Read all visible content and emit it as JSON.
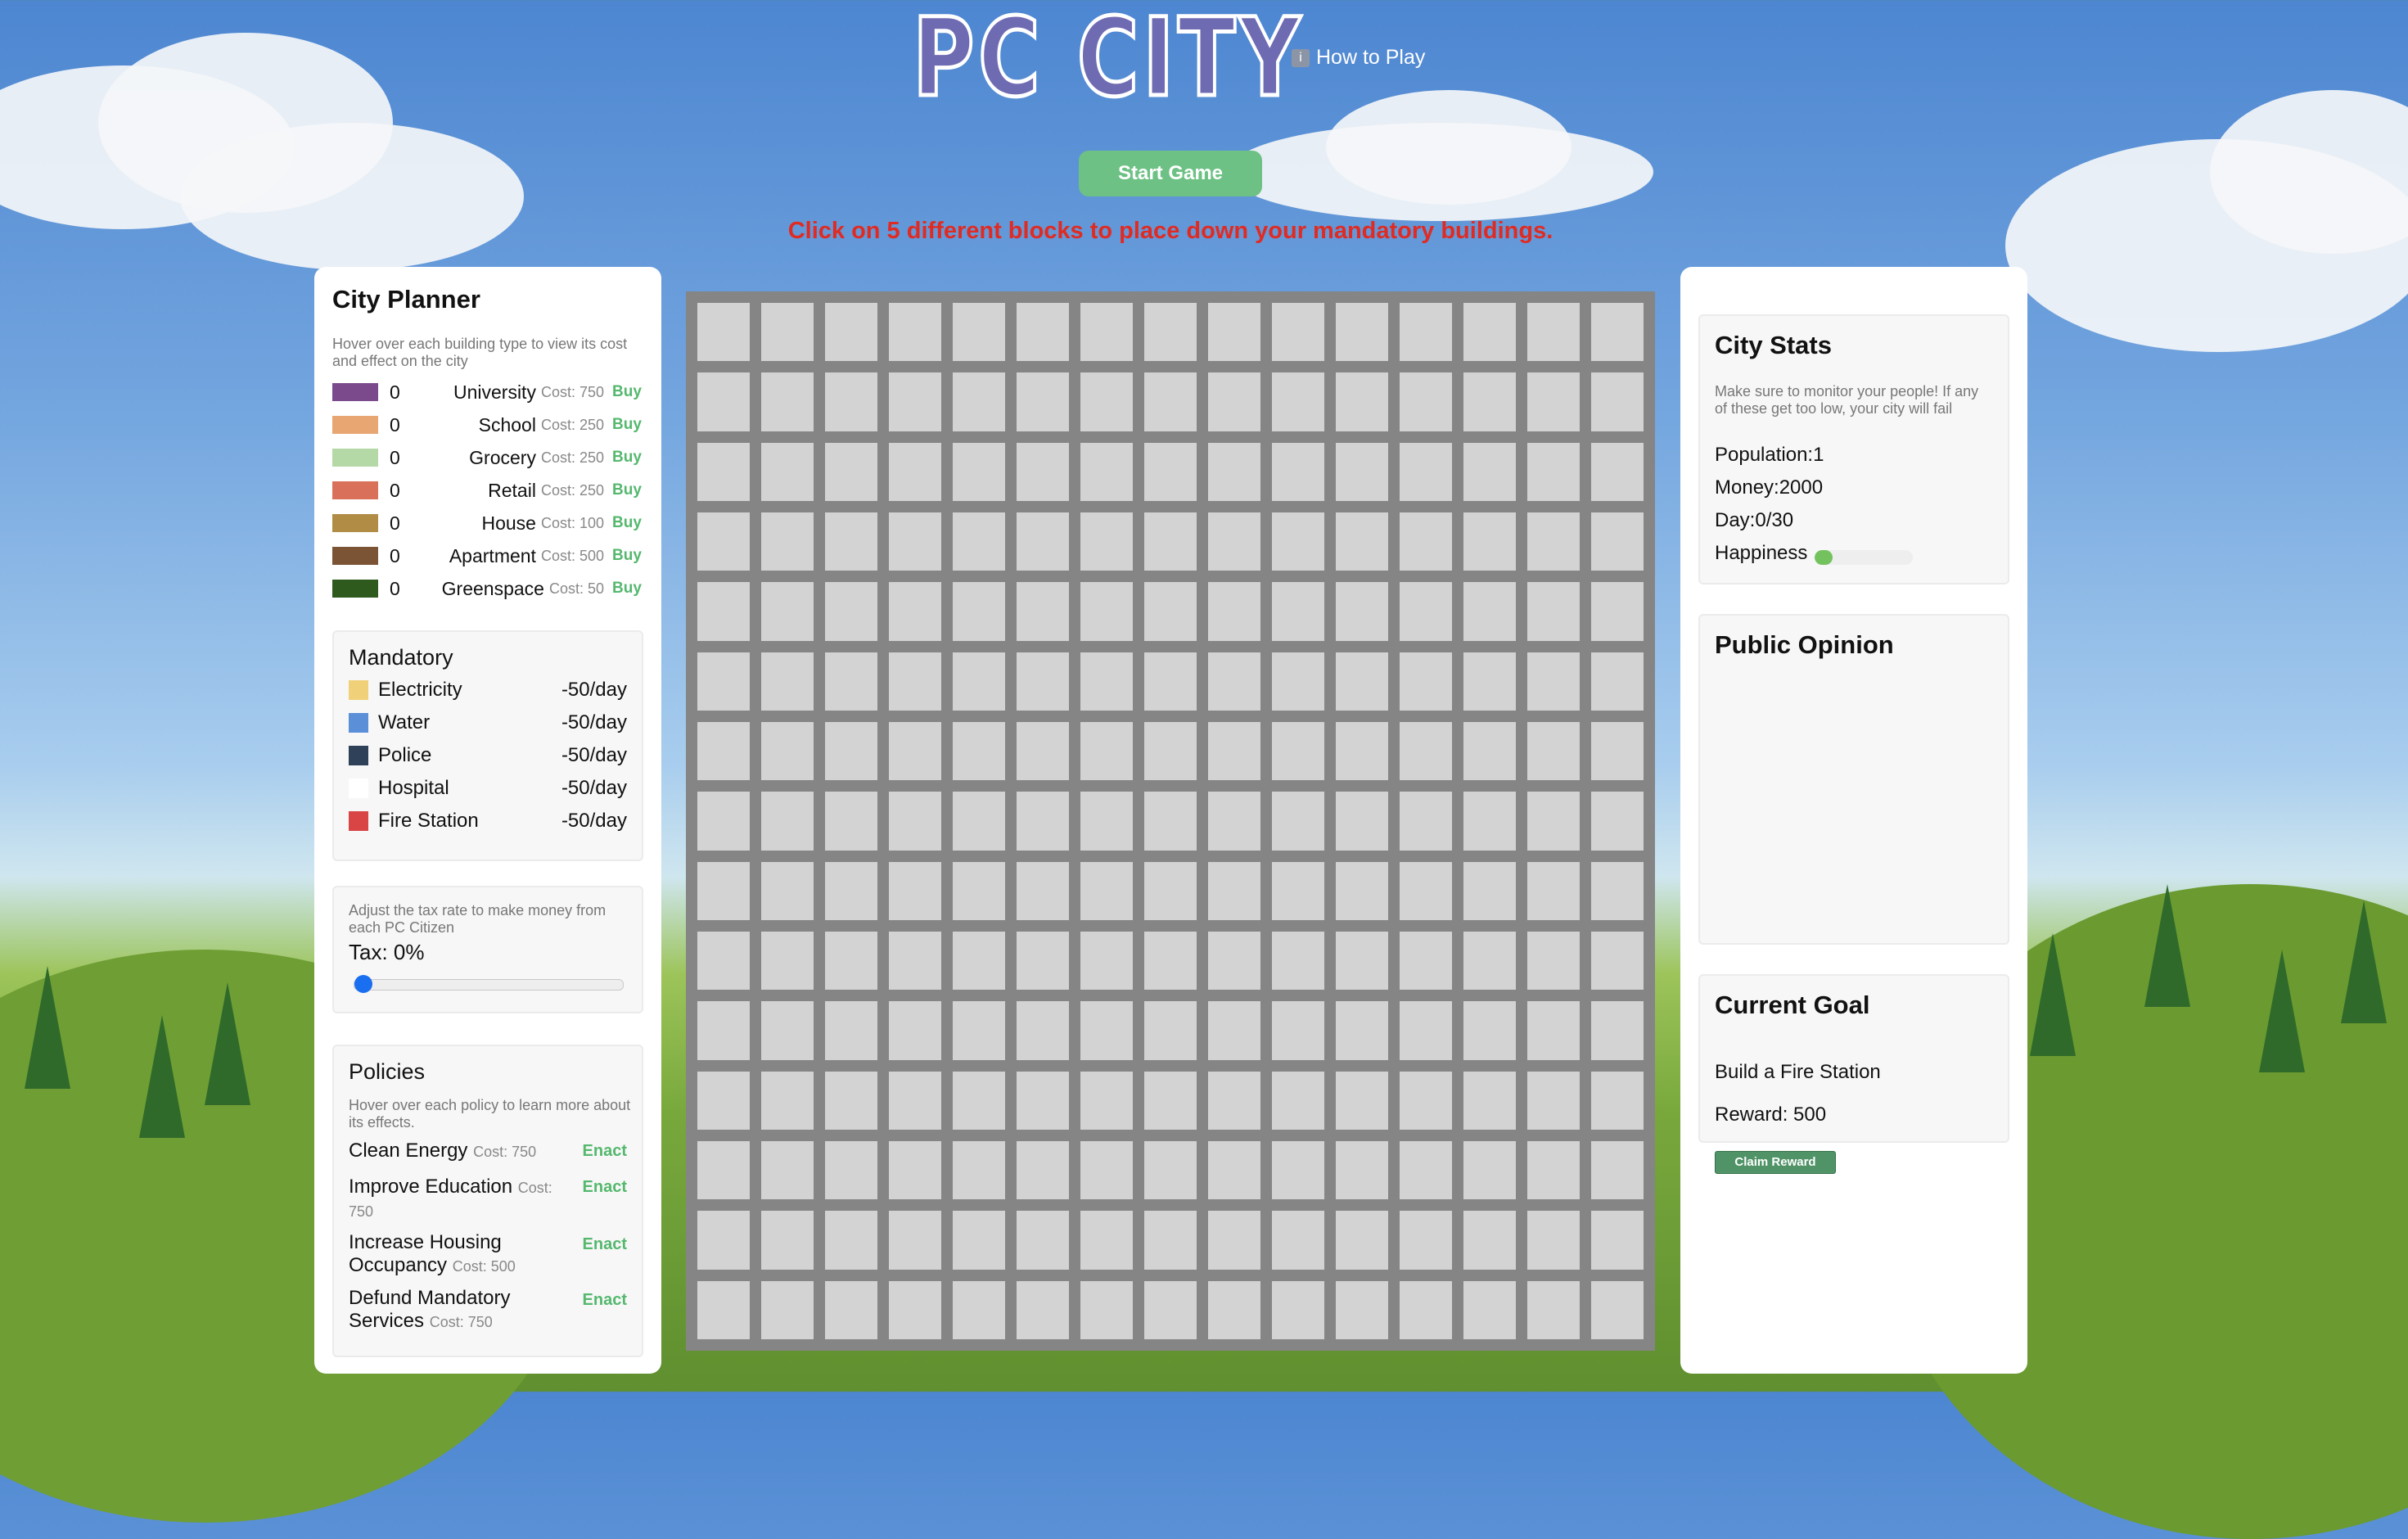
{
  "header": {
    "title": "PC CITY",
    "how_to_play": "How to Play",
    "info_icon": "i",
    "start_button": "Start Game",
    "instruction": "Click on 5 different blocks to place down your mandatory buildings."
  },
  "city_planner": {
    "title": "City Planner",
    "hint": "Hover over each building type to view its cost and effect on the city",
    "buy_label": "Buy",
    "buildings": [
      {
        "count": "0",
        "name": "University",
        "cost": "Cost: 750",
        "color": "#7a4a8c"
      },
      {
        "count": "0",
        "name": "School",
        "cost": "Cost: 250",
        "color": "#e8a673"
      },
      {
        "count": "0",
        "name": "Grocery",
        "cost": "Cost: 250",
        "color": "#b4d8a6"
      },
      {
        "count": "0",
        "name": "Retail",
        "cost": "Cost: 250",
        "color": "#d9715a"
      },
      {
        "count": "0",
        "name": "House",
        "cost": "Cost: 100",
        "color": "#b08c44"
      },
      {
        "count": "0",
        "name": "Apartment",
        "cost": "Cost: 500",
        "color": "#7a5434"
      },
      {
        "count": "0",
        "name": "Greenspace",
        "cost": "Cost: 50",
        "color": "#2f5a1e"
      }
    ]
  },
  "mandatory": {
    "title": "Mandatory",
    "items": [
      {
        "name": "Electricity",
        "cost": "-50/day",
        "color": "#f0d079"
      },
      {
        "name": "Water",
        "cost": "-50/day",
        "color": "#5b8fd8"
      },
      {
        "name": "Police",
        "cost": "-50/day",
        "color": "#2f4059"
      },
      {
        "name": "Hospital",
        "cost": "-50/day",
        "color": "#ffffff"
      },
      {
        "name": "Fire Station",
        "cost": "-50/day",
        "color": "#d94545"
      }
    ]
  },
  "tax": {
    "hint": "Adjust the tax rate to make money from each PC Citizen",
    "label": "Tax: 0%",
    "rate": 0
  },
  "policies": {
    "title": "Policies",
    "hint": "Hover over each policy to learn more about its effects.",
    "enact_label": "Enact",
    "items": [
      {
        "name": "Clean Energy",
        "cost": "Cost: 750"
      },
      {
        "name": "Improve Education",
        "cost": "Cost: 750"
      },
      {
        "name": "Increase Housing Occupancy",
        "cost": "Cost: 500"
      },
      {
        "name": "Defund Mandatory Services",
        "cost": "Cost: 750"
      }
    ]
  },
  "city_stats": {
    "title": "City Stats",
    "hint": "Make sure to monitor your people! If any of these get too low, your city will fail",
    "population": "Population:1",
    "money": "Money:2000",
    "day": "Day:0/30",
    "happiness_label": "Happiness",
    "happiness_level": 0.18
  },
  "public_opinion": {
    "title": "Public Opinion"
  },
  "current_goal": {
    "title": "Current Goal",
    "goal": "Build a Fire Station",
    "reward": "Reward: 500",
    "claim_button": "Claim Reward"
  },
  "map": {
    "rows": 15,
    "cols": 15
  }
}
